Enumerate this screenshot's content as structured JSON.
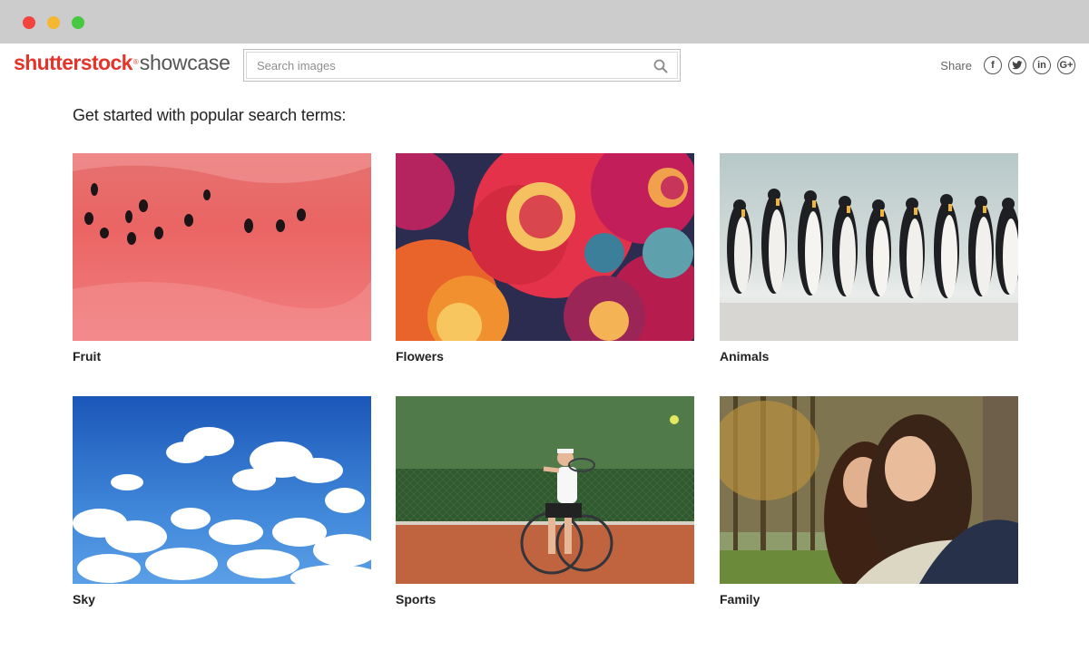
{
  "window": {
    "controls": [
      "close",
      "minimize",
      "maximize"
    ]
  },
  "logo": {
    "brand": "shutterstock",
    "tm": "®",
    "product": "showcase"
  },
  "search": {
    "placeholder": "Search images",
    "value": ""
  },
  "share": {
    "label": "Share",
    "networks": [
      "facebook-icon",
      "twitter-icon",
      "linkedin-icon",
      "google-plus-icon"
    ]
  },
  "main": {
    "heading": "Get started with popular search terms:",
    "tiles": [
      {
        "label": "Fruit"
      },
      {
        "label": "Flowers"
      },
      {
        "label": "Animals"
      },
      {
        "label": "Sky"
      },
      {
        "label": "Sports"
      },
      {
        "label": "Family"
      }
    ]
  },
  "colors": {
    "brand": "#e4352c",
    "titlebar": "#cccccc"
  }
}
